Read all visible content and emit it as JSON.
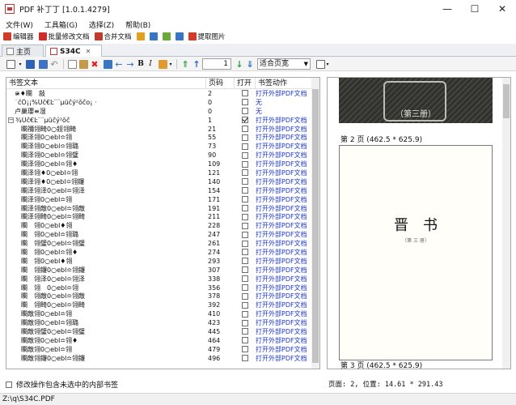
{
  "window": {
    "title": "PDF 补丁丁 [1.0.1.4279]",
    "minimize": "—",
    "maximize": "☐",
    "close": "✕"
  },
  "menu": {
    "items": [
      "文件(W)",
      "工具箱(G)",
      "选择(Z)",
      "帮助(B)"
    ]
  },
  "toolbar_main": {
    "items": [
      {
        "label": "编辑器",
        "icon": "pencil-icon",
        "color": "#d23b2a"
      },
      {
        "label": "批量修改文档",
        "icon": "pdf-icon",
        "color": "#cf2b2b"
      },
      {
        "label": "合并文档",
        "icon": "merge-icon",
        "color": "#c23a2a"
      },
      {
        "label": "",
        "icon": "split-icon",
        "color": "#e0a020"
      },
      {
        "label": "",
        "icon": "rename-icon",
        "color": "#3a75c4"
      },
      {
        "label": "",
        "icon": "ocr-icon",
        "color": "#6ca83c"
      },
      {
        "label": "",
        "icon": "info-icon",
        "color": "#3a75c4"
      },
      {
        "label": "提取图片",
        "icon": "image-icon",
        "color": "#d33b2b"
      }
    ]
  },
  "tabs": [
    {
      "label": "主页",
      "icon": "home-icon",
      "active": false
    },
    {
      "label": "S34C",
      "icon": "pdf-doc-icon",
      "active": true,
      "close": "✕"
    }
  ],
  "editor_toolbar": {
    "page_number": "1",
    "zoom": "适合页宽"
  },
  "bookmarks": {
    "columns": [
      "书签文本",
      "页码",
      "打开",
      "书签动作"
    ],
    "rows": [
      {
        "text": "≆♦瞷　敍",
        "page": "2",
        "open": false,
        "action": "打开外部PDF文档",
        "indent": 1,
        "expander": ""
      },
      {
        "text": "˙ĉÔ¡¡%Ūĉ€Ŀ¨¨µüĉý²ŏĉo¡ ·",
        "page": "0",
        "open": false,
        "action": "无",
        "indent": 1,
        "expander": ""
      },
      {
        "text": "卢巢瓔≡湿",
        "page": "0",
        "open": false,
        "action": "无",
        "indent": 1,
        "expander": ""
      },
      {
        "text": "¾Ūĉ€Ŀ¨¨µüĉý²ŏĉ",
        "page": "1",
        "open": true,
        "action": "打开外部PDF文档",
        "indent": 0,
        "expander": "−"
      },
      {
        "text": "瞷禰翎畸0○鋞翎畸",
        "page": "21",
        "open": false,
        "action": "打开外部PDF文档",
        "indent": 2,
        "expander": ""
      },
      {
        "text": "瞷泽翎0○ebl≏翎",
        "page": "55",
        "open": false,
        "action": "打开外部PDF文档",
        "indent": 2,
        "expander": ""
      },
      {
        "text": "瞷泽翎0○ebl≏翎璐",
        "page": "73",
        "open": false,
        "action": "打开外部PDF文档",
        "indent": 2,
        "expander": ""
      },
      {
        "text": "瞷泽翎0○ebl≏翎璧",
        "page": "90",
        "open": false,
        "action": "打开外部PDF文档",
        "indent": 2,
        "expander": ""
      },
      {
        "text": "瞷泽翎0○ebl≏翎♦",
        "page": "109",
        "open": false,
        "action": "打开外部PDF文档",
        "indent": 2,
        "expander": ""
      },
      {
        "text": "瞷泽翎♦0○ebl≏翎",
        "page": "121",
        "open": false,
        "action": "打开外部PDF文档",
        "indent": 2,
        "expander": ""
      },
      {
        "text": "瞷泽翎♦0○ebl≏翎鑼",
        "page": "140",
        "open": false,
        "action": "打开外部PDF文档",
        "indent": 2,
        "expander": ""
      },
      {
        "text": "瞷泽翎泽0○ebl≏翎泽",
        "page": "154",
        "open": false,
        "action": "打开外部PDF文档",
        "indent": 2,
        "expander": ""
      },
      {
        "text": "瞷泽翎0○ebl≏翎",
        "page": "171",
        "open": false,
        "action": "打开外部PDF文档",
        "indent": 2,
        "expander": ""
      },
      {
        "text": "瞷泽翎敵0○ebl≏翎敵",
        "page": "191",
        "open": false,
        "action": "打开外部PDF文档",
        "indent": 2,
        "expander": ""
      },
      {
        "text": "瞷泽翎畸0○ebl≏翎畸",
        "page": "211",
        "open": false,
        "action": "打开外部PDF文档",
        "indent": 2,
        "expander": ""
      },
      {
        "text": "瞷　翎0○ebl♦翎",
        "page": "228",
        "open": false,
        "action": "打开外部PDF文档",
        "indent": 2,
        "expander": ""
      },
      {
        "text": "瞷　翎0○ebl≏翎璐",
        "page": "247",
        "open": false,
        "action": "打开外部PDF文档",
        "indent": 2,
        "expander": ""
      },
      {
        "text": "瞷　翎璧0○ebl≏翎璧",
        "page": "261",
        "open": false,
        "action": "打开外部PDF文档",
        "indent": 2,
        "expander": ""
      },
      {
        "text": "瞷　翎0○ebl≏翎♦",
        "page": "274",
        "open": false,
        "action": "打开外部PDF文档",
        "indent": 2,
        "expander": ""
      },
      {
        "text": "瞷　翎0○ebl♦翎",
        "page": "293",
        "open": false,
        "action": "打开外部PDF文档",
        "indent": 2,
        "expander": ""
      },
      {
        "text": "瞷　翎鑼0○ebl≏翎鑼",
        "page": "307",
        "open": false,
        "action": "打开外部PDF文档",
        "indent": 2,
        "expander": ""
      },
      {
        "text": "瞷　翎泽0○ebl≏翎泽",
        "page": "338",
        "open": false,
        "action": "打开外部PDF文档",
        "indent": 2,
        "expander": ""
      },
      {
        "text": "瞷　翎　0○ebl≏翎",
        "page": "356",
        "open": false,
        "action": "打开外部PDF文档",
        "indent": 2,
        "expander": ""
      },
      {
        "text": "瞷　翎敵0○ebl≏翎敵",
        "page": "378",
        "open": false,
        "action": "打开外部PDF文档",
        "indent": 2,
        "expander": ""
      },
      {
        "text": "瞷　翎畸0○ebl≏翎畸",
        "page": "392",
        "open": false,
        "action": "打开外部PDF文档",
        "indent": 2,
        "expander": ""
      },
      {
        "text": "瞷敵翎0○ebl≏翎",
        "page": "410",
        "open": false,
        "action": "打开外部PDF文档",
        "indent": 2,
        "expander": ""
      },
      {
        "text": "瞷敵翎0○ebl≏翎璐",
        "page": "423",
        "open": false,
        "action": "打开外部PDF文档",
        "indent": 2,
        "expander": ""
      },
      {
        "text": "瞷敵翎璧0○ebl≏翎璧",
        "page": "445",
        "open": false,
        "action": "打开外部PDF文档",
        "indent": 2,
        "expander": ""
      },
      {
        "text": "瞷敵翎0○ebl≏翎♦",
        "page": "464",
        "open": false,
        "action": "打开外部PDF文档",
        "indent": 2,
        "expander": ""
      },
      {
        "text": "瞷敵翎0○ebl≏翎",
        "page": "479",
        "open": false,
        "action": "打开外部PDF文档",
        "indent": 2,
        "expander": ""
      },
      {
        "text": "瞷敵翎鑼0○ebl≏翎鑼",
        "page": "496",
        "open": false,
        "action": "打开外部PDF文档",
        "indent": 2,
        "expander": ""
      }
    ]
  },
  "option_label": "修改操作包含未选中的内部书签",
  "preview": {
    "cover_label": "（第三册）",
    "page2_caption": "第 2 页 (462.5 * 625.9)",
    "page2_title": "晋书",
    "page2_subtitle": "（第 三 册）",
    "page3_caption": "第 3 页 (462.5 * 625.9)"
  },
  "position_status": "页面: 2, 位置: 14.61 * 291.43",
  "statusbar": {
    "path": "Z:\\q\\S34C.PDF"
  }
}
